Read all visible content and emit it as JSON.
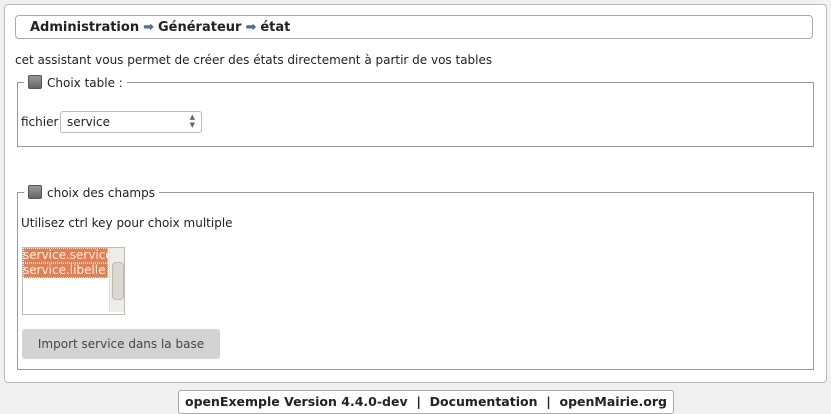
{
  "breadcrumb": [
    "Administration",
    "Générateur",
    "état"
  ],
  "intro": "cet assistant vous permet de créer des états directement à partir de vos tables",
  "table_section": {
    "legend": "Choix table :",
    "label": "fichier",
    "selected": "service"
  },
  "fields_section": {
    "legend": "choix des champs",
    "hint": "Utilisez ctrl key pour choix multiple",
    "options": [
      "service.service",
      "service.libelle"
    ]
  },
  "import_button": "Import service dans la base",
  "footer": {
    "version": "openExemple Version 4.4.0-dev",
    "documentation": "Documentation",
    "site": "openMairie.org",
    "separator": "|"
  },
  "colors": {
    "selection": "#f07a48",
    "arrow": "#4a6fa8"
  }
}
